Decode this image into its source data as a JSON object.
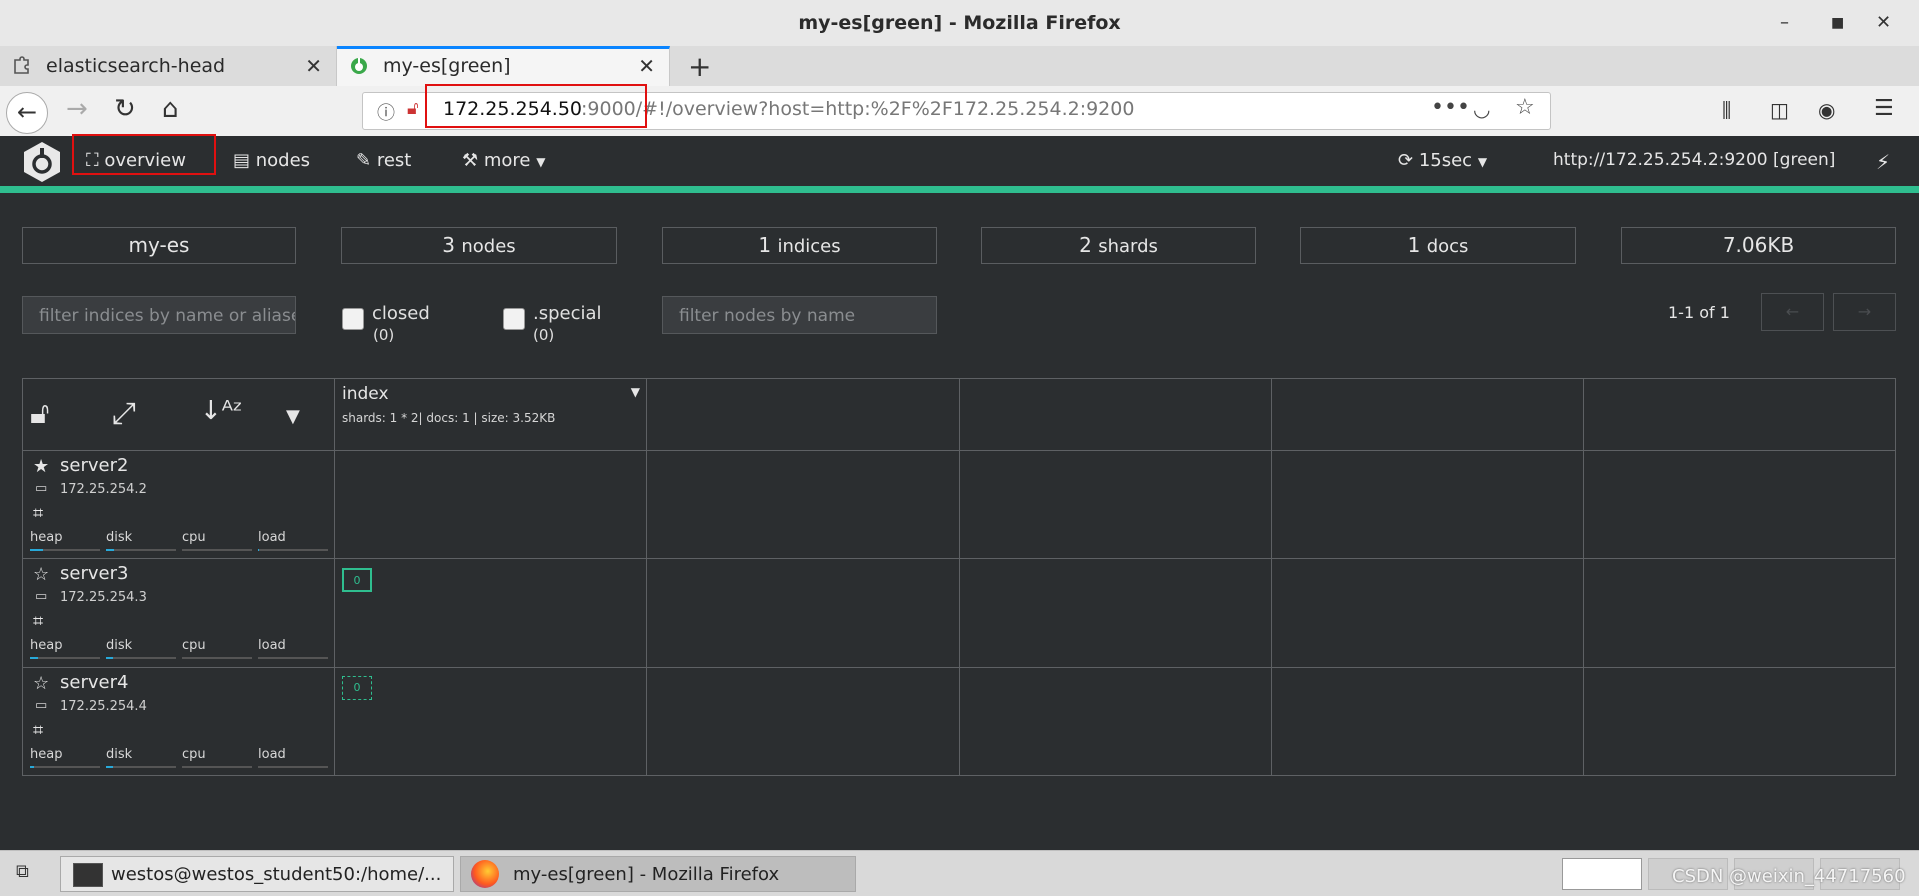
{
  "window": {
    "title": "my-es[green] - Mozilla Firefox"
  },
  "tabs": [
    {
      "label": "elasticsearch-head"
    },
    {
      "label": "my-es[green]"
    }
  ],
  "url": {
    "host": "172.25.254.50",
    "rest": ":9000/#!/overview?host=http:%2F%2F172.25.254.2:9200"
  },
  "app": {
    "nav": {
      "overview": "overview",
      "nodes": "nodes",
      "rest": "rest",
      "more": "more"
    },
    "refresh": "15sec",
    "connection": "http://172.25.254.2:9200 [green]"
  },
  "stats": [
    {
      "num": "my-es",
      "unit": ""
    },
    {
      "num": "3",
      "unit": "nodes"
    },
    {
      "num": "1",
      "unit": "indices"
    },
    {
      "num": "2",
      "unit": "shards"
    },
    {
      "num": "1",
      "unit": "docs"
    },
    {
      "num": "7.06KB",
      "unit": ""
    }
  ],
  "filters": {
    "indices_placeholder": "filter indices by name or aliases",
    "nodes_placeholder": "filter nodes by name",
    "closed_label": "closed",
    "closed_count": "(0)",
    "special_label": ".special",
    "special_count": "(0)",
    "pager": "1-1 of 1"
  },
  "index": {
    "name": "index",
    "info": "shards: 1 * 2| docs: 1 | size: 3.52KB"
  },
  "metric_labels": {
    "heap": "heap",
    "disk": "disk",
    "cpu": "cpu",
    "load": "load"
  },
  "nodes": [
    {
      "name": "server2",
      "ip": "172.25.254.2",
      "master": true,
      "shard": "",
      "heap": 0.18,
      "disk": 0.12,
      "cpu": 0,
      "load": 0.02
    },
    {
      "name": "server3",
      "ip": "172.25.254.3",
      "master": false,
      "shard": "0",
      "heap": 0.12,
      "disk": 0.1,
      "cpu": 0,
      "load": 0
    },
    {
      "name": "server4",
      "ip": "172.25.254.4",
      "master": false,
      "shard": "0",
      "heap": 0.06,
      "disk": 0.1,
      "cpu": 0,
      "load": 0
    }
  ],
  "taskbar": [
    {
      "label": "westos@westos_student50:/home/..."
    },
    {
      "label": "my-es[green] - Mozilla Firefox"
    }
  ],
  "watermark": "CSDN @weixin_44717560",
  "colors": {
    "accent": "#2fbe8f",
    "highlight": "#e01010",
    "tab_active": "#0a84ff"
  }
}
